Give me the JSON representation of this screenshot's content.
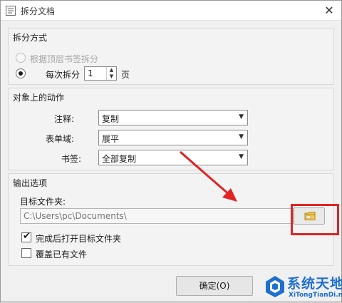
{
  "window": {
    "title": "拆分文档",
    "close_glyph": "✕"
  },
  "split_method": {
    "title": "拆分方式",
    "by_bookmark_label": "根据顶层书签拆分",
    "by_page_label": "每次拆分",
    "pages_value": "1",
    "pages_unit": "页",
    "selected": "by_page"
  },
  "actions": {
    "title": "对象上的动作",
    "annotation_label": "注释:",
    "annotation_value": "复制",
    "form_field_label": "表单域:",
    "form_field_value": "展平",
    "bookmark_label": "书签:",
    "bookmark_value": "全部复制"
  },
  "output": {
    "title": "输出选项",
    "target_folder_label": "目标文件夹:",
    "target_folder_value": "C:\\Users\\pc\\Documents\\",
    "open_after_label": "完成后打开目标文件夹",
    "open_after_checked": true,
    "overwrite_label": "覆盖已有文件",
    "overwrite_checked": false
  },
  "footer": {
    "ok_label": "确定(O)"
  },
  "watermark": {
    "name": "系统天地",
    "url": "XiTongTianDi.net"
  },
  "colors": {
    "highlight": "#e12424",
    "watermark": "#1e6fd0"
  },
  "icons": {
    "app": "document-icon",
    "browse": "folder-icon"
  }
}
